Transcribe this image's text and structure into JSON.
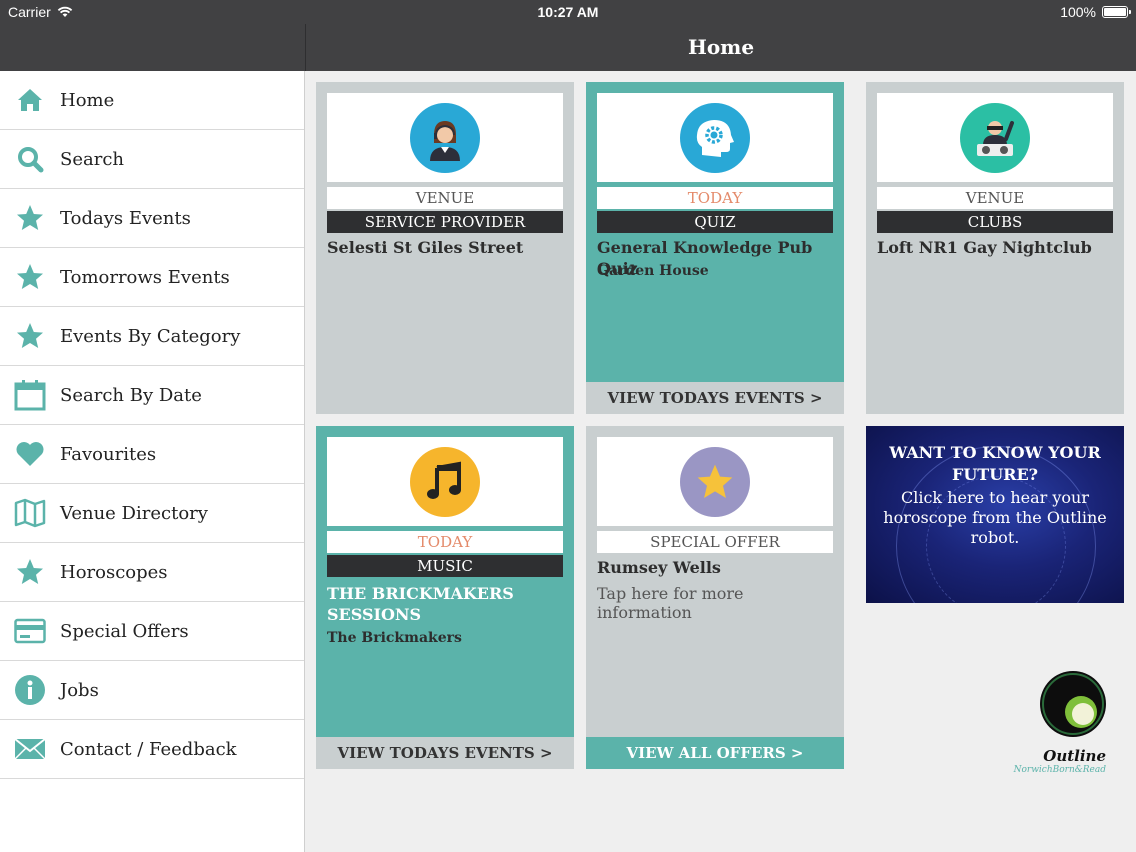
{
  "status_bar": {
    "carrier": "Carrier",
    "time": "10:27 AM",
    "battery": "100%"
  },
  "nav": {
    "title": "Home"
  },
  "sidebar": {
    "items": [
      {
        "label": "Home",
        "icon": "home-icon"
      },
      {
        "label": "Search",
        "icon": "search-icon"
      },
      {
        "label": "Todays Events",
        "icon": "star-icon"
      },
      {
        "label": "Tomorrows Events",
        "icon": "star-icon"
      },
      {
        "label": "Events By Category",
        "icon": "star-icon"
      },
      {
        "label": "Search By Date",
        "icon": "calendar-icon"
      },
      {
        "label": "Favourites",
        "icon": "heart-icon"
      },
      {
        "label": "Venue Directory",
        "icon": "map-icon"
      },
      {
        "label": "Horoscopes",
        "icon": "star-icon"
      },
      {
        "label": "Special Offers",
        "icon": "credit-card-icon"
      },
      {
        "label": "Jobs",
        "icon": "info-icon"
      },
      {
        "label": "Contact / Feedback",
        "icon": "envelope-icon"
      }
    ]
  },
  "tiles": {
    "venue1": {
      "tag": "VENUE",
      "category": "SERVICE PROVIDER",
      "name": "Selesti St Giles Street",
      "icon": "service-person-icon",
      "icon_color": "#29a8d6"
    },
    "quiz": {
      "tag": "TODAY",
      "category": "QUIZ",
      "name": "General Knowledge Pub Quiz",
      "venue": "Garden House",
      "footer": "VIEW TODAYS EVENTS >",
      "icon": "brain-gear-icon",
      "icon_color": "#29a8d6"
    },
    "venue2": {
      "tag": "VENUE",
      "category": "CLUBS",
      "name": "Loft NR1 Gay Nightclub",
      "icon": "dj-icon",
      "icon_color": "#2bbfa4"
    },
    "music": {
      "tag": "TODAY",
      "category": "MUSIC",
      "name": "THE BRICKMAKERS SESSIONS",
      "venue": "The Brickmakers",
      "footer": "VIEW TODAYS EVENTS >",
      "icon": "music-note-icon",
      "icon_color": "#f6b52c"
    },
    "offer": {
      "tag": "SPECIAL OFFER",
      "name": "Rumsey Wells",
      "description": "Tap here for more information",
      "footer": "VIEW ALL OFFERS >",
      "icon": "star-badge-icon",
      "icon_color": "#9a96c4"
    }
  },
  "horoscope_banner": {
    "headline": "WANT TO KNOW YOUR FUTURE?",
    "text": "Click here to hear your horoscope from the Outline robot."
  },
  "logo": {
    "name": "Outline",
    "tagline": "NorwichBorn&Read"
  },
  "colors": {
    "teal": "#5bb3aa",
    "dark": "#414143",
    "today_tag": "#e48a6a"
  }
}
